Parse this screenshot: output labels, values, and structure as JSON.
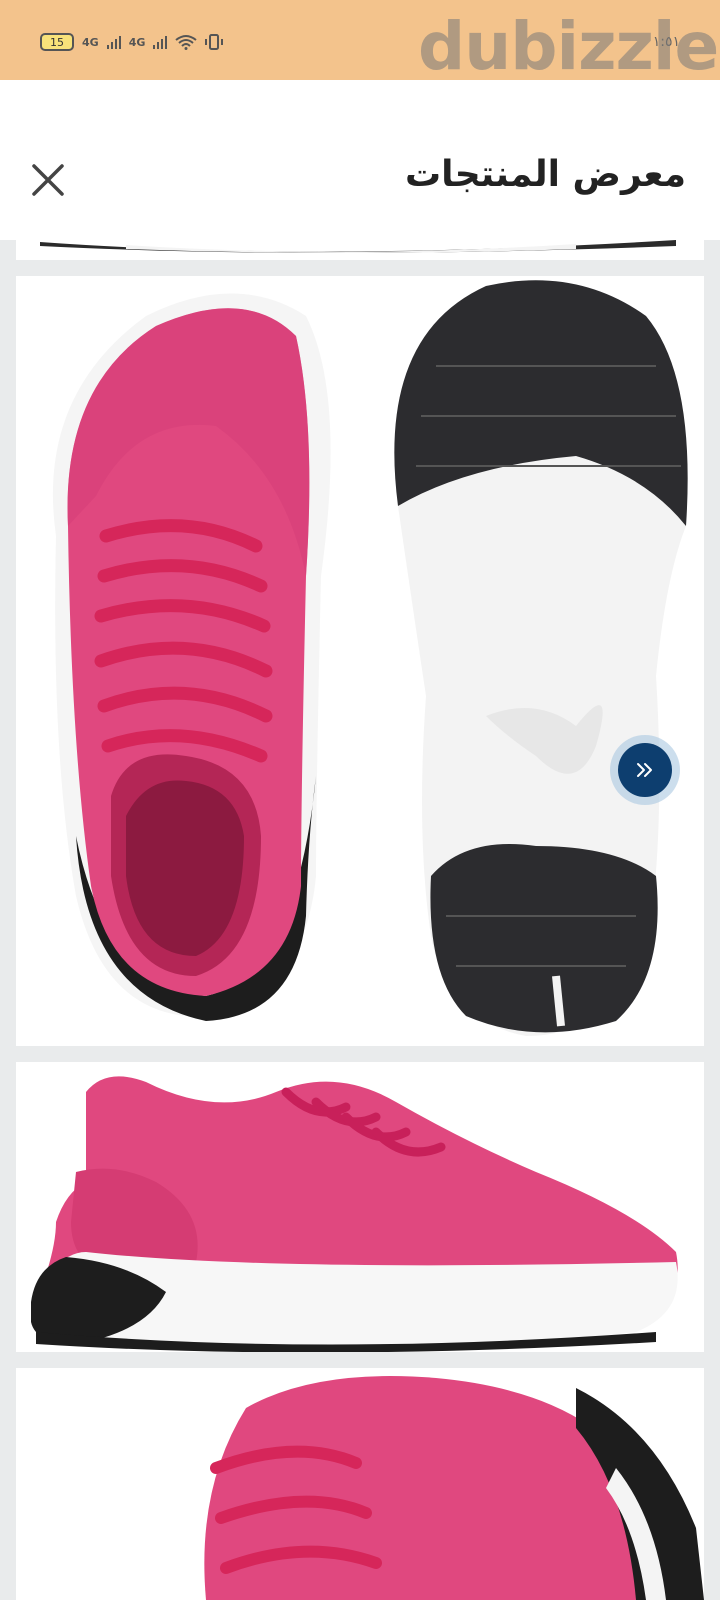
{
  "status_bar": {
    "battery": "15",
    "network1": "4G",
    "network2": "4G",
    "time": "١:٥١"
  },
  "watermark": "dubizzle",
  "header": {
    "title": "معرض المنتجات",
    "close_icon": "close-icon"
  },
  "gallery": {
    "images": [
      "shoe-bottom-edge",
      "shoe-top-and-sole",
      "shoe-side-view",
      "shoe-heel-closeup"
    ],
    "next_icon": "double-chevron-right-icon"
  },
  "colors": {
    "status_bar": "#f3c38c",
    "gallery_bg": "#e9ebec",
    "shoe_pink": "#e0487f",
    "next_button": "#0d3e6f"
  }
}
